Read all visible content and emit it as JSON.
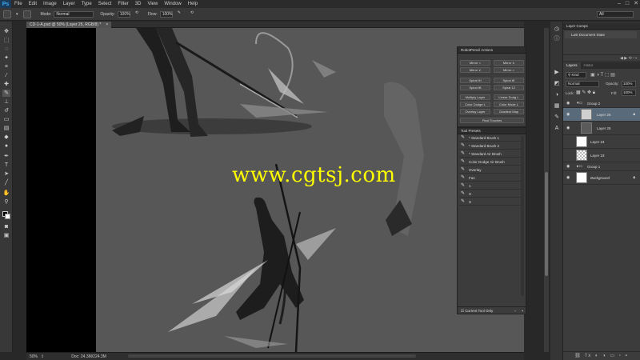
{
  "app": {
    "logo": "Ps"
  },
  "menu": [
    "File",
    "Edit",
    "Image",
    "Layer",
    "Type",
    "Select",
    "Filter",
    "3D",
    "View",
    "Window",
    "Help"
  ],
  "window_controls": {
    "minimize": "–",
    "maximize": "□",
    "close": "✕"
  },
  "options": {
    "mode_label": "Mode:",
    "mode_value": "Normal",
    "opacity_label": "Opacity:",
    "opacity_value": "100%",
    "flow_label": "Flow:",
    "flow_value": "100%",
    "workspace": "All"
  },
  "document": {
    "tab_title": "CD-1-A.psd @ 50% (Layer 26, RGB/8) *",
    "tab_close": "×"
  },
  "status": {
    "zoom": "50%",
    "doc_size": "Doc: 24.3M/224.3M"
  },
  "watermark": "www.cgtsj.com",
  "actions_panel": {
    "title": "RobotPencil Actions",
    "rows": [
      [
        "Mirror <",
        "Mirror ∧"
      ],
      [
        "Mirror ∨",
        "Mirror >"
      ],
      [
        "Spiral tH",
        "Spiral tE"
      ],
      [
        "Spiral tB",
        "Spiral 12"
      ],
      [
        "Multiply Layer",
        "Linear Dodg L"
      ],
      [
        "Color Dodge L",
        "Color Mode L"
      ],
      [
        "Overlay Layer",
        "Gradient Map"
      ]
    ],
    "final": "Final Touches"
  },
  "tool_presets": {
    "title": "Tool Presets",
    "items": [
      "* Standard Brush 1",
      "* Standard Brush 2",
      "* Standard Air Brush",
      "Color Dodge Air Brush",
      "Overlay",
      "Fan",
      "1",
      "H",
      "S"
    ],
    "current_tool_only": "Current Tool Only"
  },
  "layer_comps": {
    "title": "Layer Comps",
    "last_state": "Last Document State"
  },
  "layers_panel": {
    "tabs": [
      "Layers",
      "Histor"
    ],
    "kind": "Kind",
    "blend": "Normal",
    "opacity_label": "Opacity:",
    "opacity_value": "100%",
    "lock_label": "Lock:",
    "fill_label": "Fill:",
    "fill_value": "100%",
    "layers": [
      {
        "name": "Group 2",
        "type": "group",
        "visible": true
      },
      {
        "name": "Layer 26",
        "type": "layer",
        "visible": true,
        "selected": true
      },
      {
        "name": "Layer 25",
        "type": "layer",
        "visible": true
      },
      {
        "name": "Layer 24",
        "type": "layer",
        "visible": false
      },
      {
        "name": "Layer 23",
        "type": "layer",
        "visible": false
      },
      {
        "name": "Group 1",
        "type": "group",
        "visible": true
      },
      {
        "name": "Background",
        "type": "background",
        "visible": true
      }
    ]
  },
  "colors": {
    "accent": "#596a7a",
    "watermark": "#ffff00",
    "canvas": "#575757"
  }
}
